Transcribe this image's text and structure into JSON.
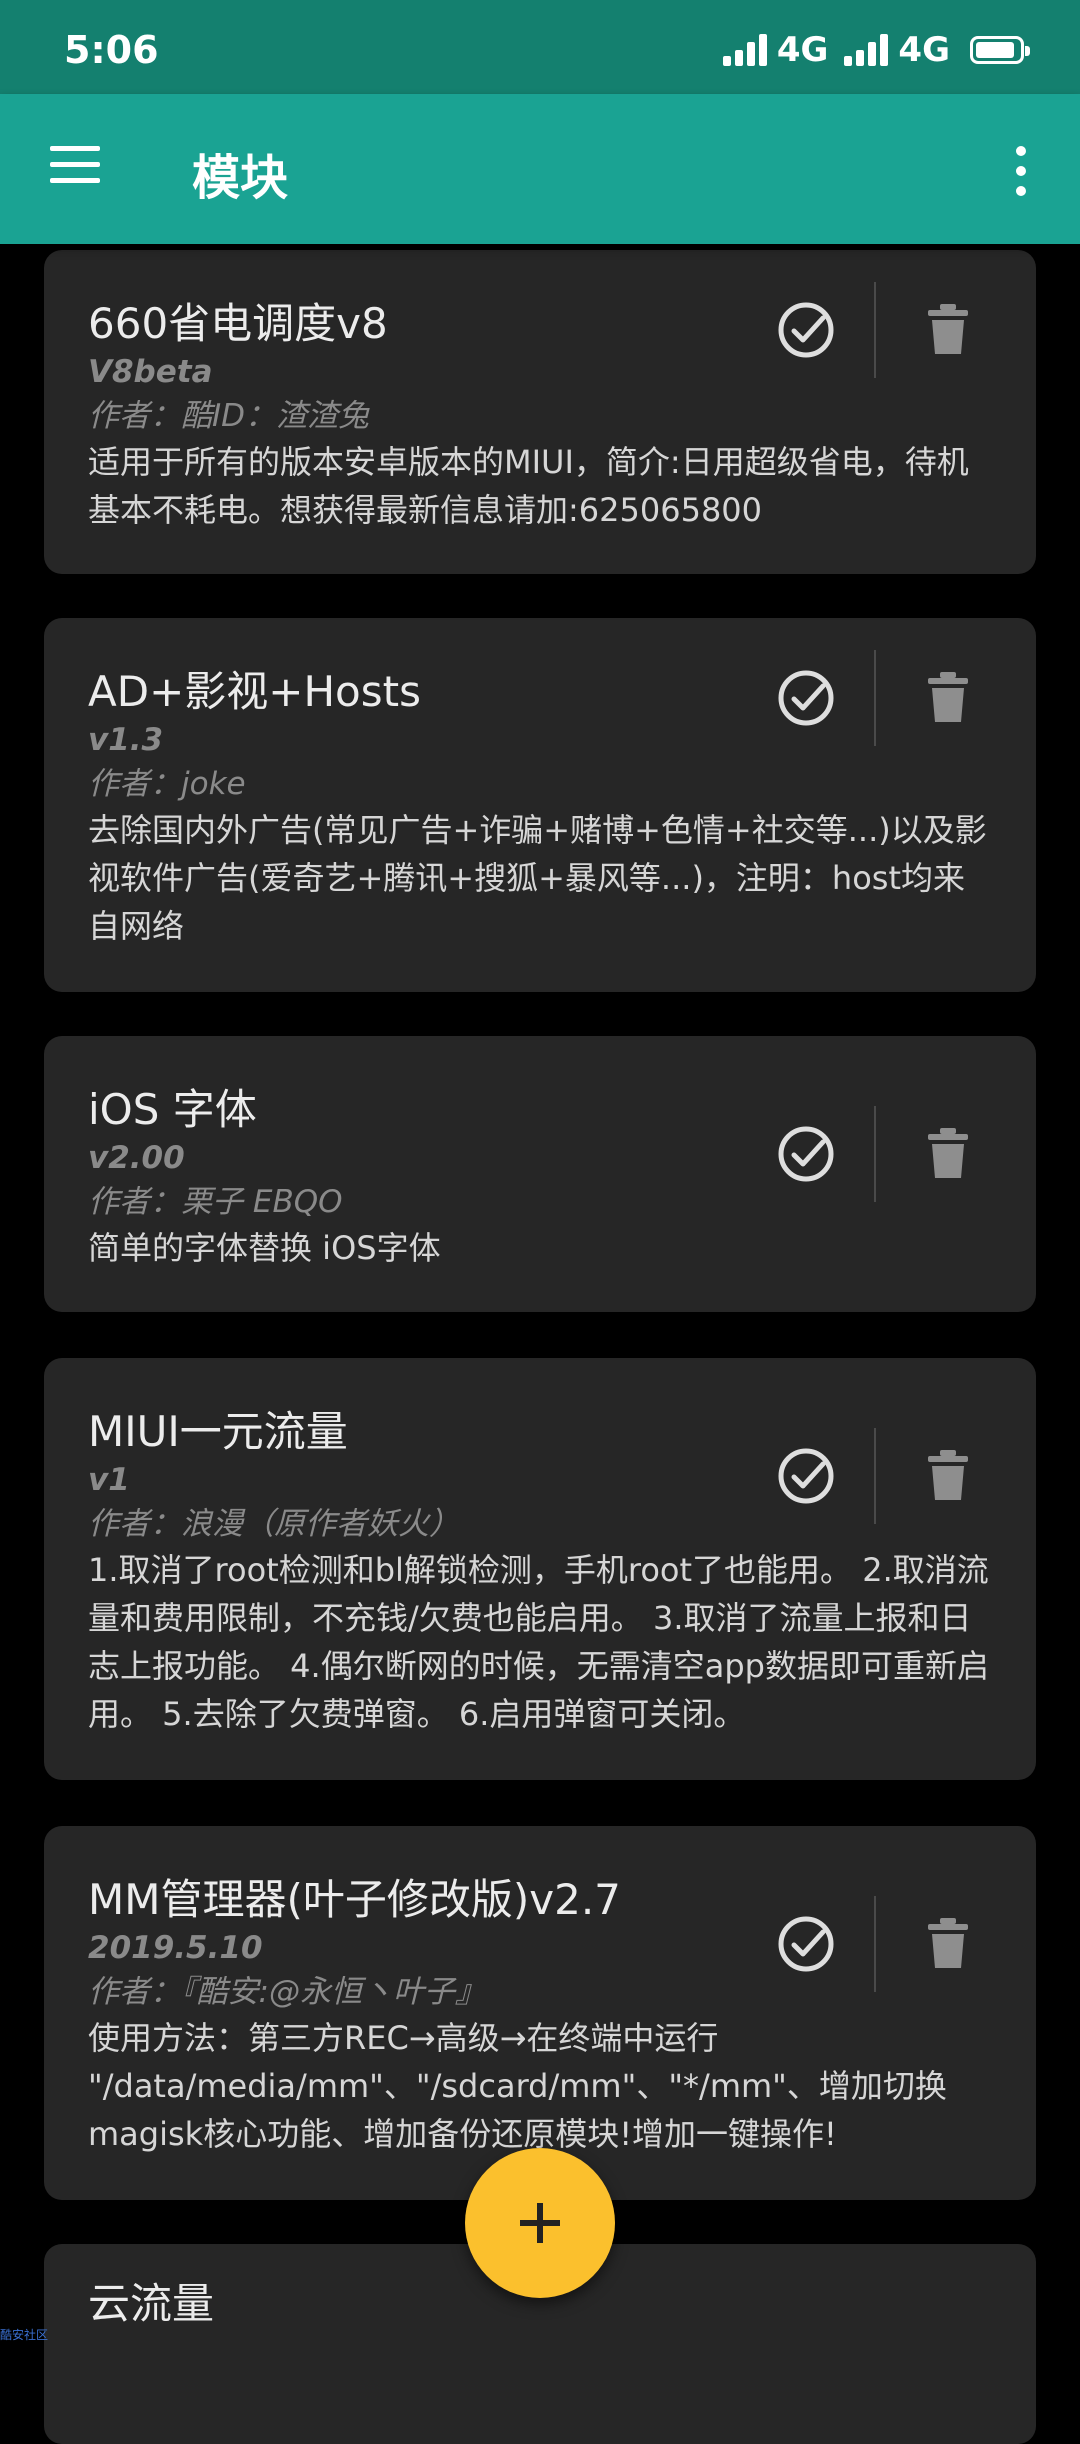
{
  "status_bar": {
    "time": "5:06",
    "network_1": "4G",
    "network_2": "4G"
  },
  "app_bar": {
    "title": "模块"
  },
  "modules": [
    {
      "name": "660省电调度v8",
      "version": "V8beta",
      "author": "作者：酷ID：渣渣兔",
      "description": "适用于所有的版本安卓版本的MIUI，简介:日用超级省电，待机基本不耗电。想获得最新信息请加:625065800"
    },
    {
      "name": "AD+影视+Hosts",
      "version": "v1.3",
      "author": "作者：joke",
      "description": "去除国内外广告(常见广告+诈骗+赌博+色情+社交等...)以及影视软件广告(爱奇艺+腾讯+搜狐+暴风等...)，注明：host均来自网络"
    },
    {
      "name": "iOS 字体",
      "version": "v2.00",
      "author": "作者：栗子 EBQO",
      "description": "简单的字体替换 iOS字体"
    },
    {
      "name": "MIUI一元流量",
      "version": "v1",
      "author": "作者：浪漫（原作者妖火）",
      "description": "1.取消了root检测和bl解锁检测，手机root了也能用。 2.取消流量和费用限制，不充钱/欠费也能启用。 3.取消了流量上报和日志上报功能。 4.偶尔断网的时候，无需清空app数据即可重新启用。 5.去除了欠费弹窗。 6.启用弹窗可关闭。"
    },
    {
      "name": "MM管理器(叶子修改版)v2.7",
      "version": "2019.5.10",
      "author": "作者：『酷安:@永恒丶叶子』",
      "description": "使用方法：第三方REC→高级→在终端中运行 \"/data/media/mm\"、\"/sdcard/mm\"、\"*/mm\"、增加切换 magisk核心功能、增加备份还原模块!增加一键操作!"
    },
    {
      "name": "云流量",
      "version": "",
      "author": "",
      "description": ""
    }
  ],
  "watermark": "酷安社区",
  "colors": {
    "status_bar": "#14806f",
    "app_bar": "#1aa393",
    "card": "#262626",
    "fab": "#fbc02d",
    "icon": "#dedede"
  },
  "icons": {
    "menu": "menu-icon",
    "more": "more-vert-icon",
    "check": "check-circle-icon",
    "delete": "trash-icon",
    "add": "plus-icon"
  }
}
